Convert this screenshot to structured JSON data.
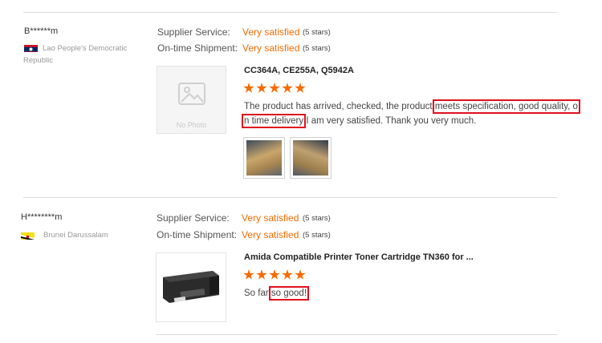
{
  "reviews": [
    {
      "buyer": "B******m",
      "country": "Lao People's Democratic Republic",
      "supplier_service_label": "Supplier Service:",
      "supplier_service_value": "Very satisfied",
      "supplier_service_stars": "(5 stars)",
      "ontime_label": "On-time Shipment:",
      "ontime_value": "Very satisfied",
      "ontime_stars": "(5 stars)",
      "product_title": "CC364A, CE255A, Q5942A",
      "rating": 5,
      "review_part1": "The product has arrived, checked, the product ",
      "review_highlight1": "meets specification, good quality, o",
      "review_highlight2": "n time delivery",
      "review_part2": " I am very satisfied. Thank you very much.",
      "image_placeholder": "No Photo"
    },
    {
      "buyer": "H********m",
      "country": "Brunei Darussalam",
      "supplier_service_label": "Supplier Service:",
      "supplier_service_value": "Very satisfied",
      "supplier_service_stars": "(5 stars)",
      "ontime_label": "On-time Shipment:",
      "ontime_value": "Very satisfied",
      "ontime_stars": "(5 stars)",
      "product_title": "Amida Compatible Printer Toner Cartridge TN360 for ...",
      "rating": 5,
      "review_part1": "So far ",
      "review_highlight1": "so good!"
    }
  ],
  "colors": {
    "accent": "#f56b00",
    "highlight": "#e01020"
  }
}
